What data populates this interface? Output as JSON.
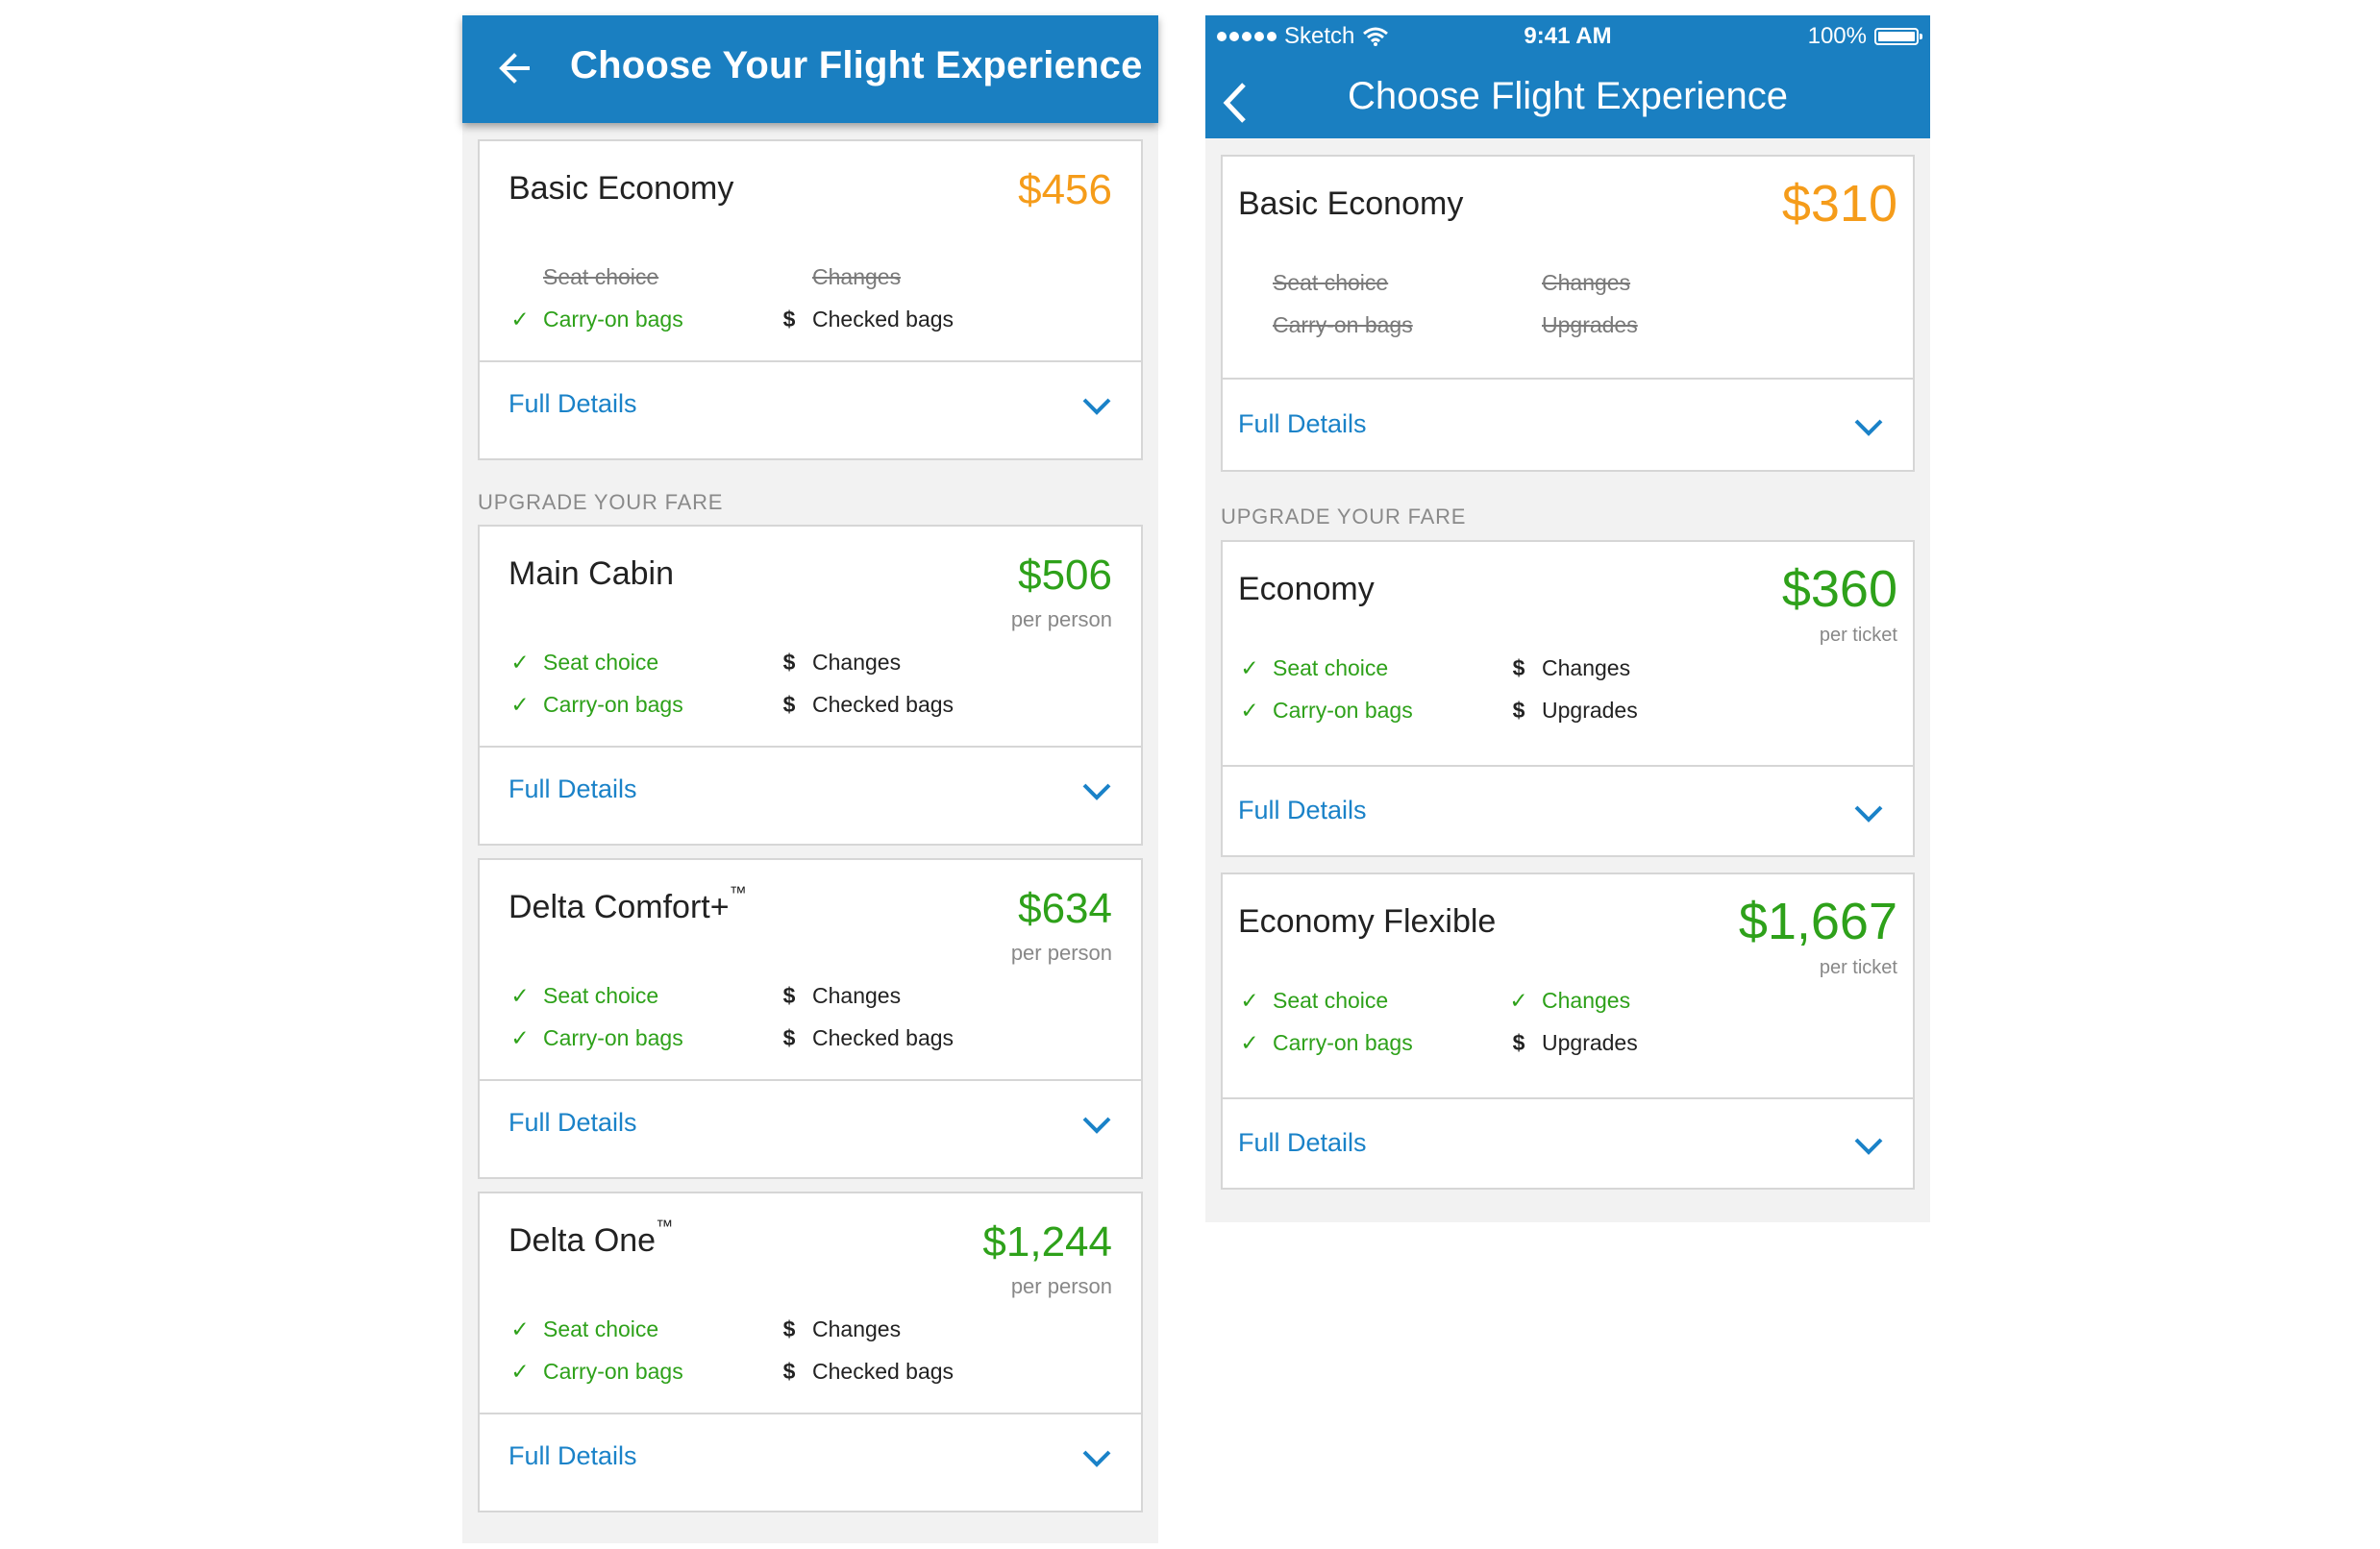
{
  "android": {
    "title": "Choose Your Flight Experience",
    "section_label": "UPGRADE YOUR FARE",
    "fares": [
      {
        "name": "Basic Economy",
        "price": "$456",
        "price_color": "#f59c1a",
        "per": "",
        "features": [
          {
            "label": "Seat choice",
            "status": "excluded"
          },
          {
            "label": "Changes",
            "status": "excluded"
          },
          {
            "label": "Carry-on bags",
            "status": "included"
          },
          {
            "label": "Checked bags",
            "status": "fee"
          }
        ],
        "details": "Full Details"
      },
      {
        "name": "Main Cabin",
        "price": "$506",
        "price_color": "#2ea11a",
        "per": "per person",
        "features": [
          {
            "label": "Seat choice",
            "status": "included"
          },
          {
            "label": "Changes",
            "status": "fee"
          },
          {
            "label": "Carry-on bags",
            "status": "included"
          },
          {
            "label": "Checked bags",
            "status": "fee"
          }
        ],
        "details": "Full Details"
      },
      {
        "name": "Delta Comfort+",
        "tm": "™",
        "price": "$634",
        "price_color": "#2ea11a",
        "per": "per person",
        "features": [
          {
            "label": "Seat choice",
            "status": "included"
          },
          {
            "label": "Changes",
            "status": "fee"
          },
          {
            "label": "Carry-on bags",
            "status": "included"
          },
          {
            "label": "Checked bags",
            "status": "fee"
          }
        ],
        "details": "Full Details"
      },
      {
        "name": "Delta One",
        "tm": "™",
        "price": "$1,244",
        "price_color": "#2ea11a",
        "per": "per person",
        "features": [
          {
            "label": "Seat choice",
            "status": "included"
          },
          {
            "label": "Changes",
            "status": "fee"
          },
          {
            "label": "Carry-on bags",
            "status": "included"
          },
          {
            "label": "Checked bags",
            "status": "fee"
          }
        ],
        "details": "Full Details"
      }
    ]
  },
  "ios": {
    "status": {
      "carrier": "Sketch",
      "time": "9:41 AM",
      "battery": "100%"
    },
    "title": "Choose Flight Experience",
    "section_label": "UPGRADE YOUR FARE",
    "fares": [
      {
        "name": "Basic Economy",
        "price": "$310",
        "price_color": "#f59c1a",
        "per": "",
        "features": [
          {
            "label": "Seat choice",
            "status": "excluded"
          },
          {
            "label": "Changes",
            "status": "excluded"
          },
          {
            "label": "Carry-on bags",
            "status": "excluded"
          },
          {
            "label": "Upgrades",
            "status": "excluded"
          }
        ],
        "details": "Full Details"
      },
      {
        "name": "Economy",
        "price": "$360",
        "price_color": "#2ea11a",
        "per": "per ticket",
        "features": [
          {
            "label": "Seat choice",
            "status": "included"
          },
          {
            "label": "Changes",
            "status": "fee"
          },
          {
            "label": "Carry-on bags",
            "status": "included"
          },
          {
            "label": "Upgrades",
            "status": "fee"
          }
        ],
        "details": "Full Details"
      },
      {
        "name": "Economy Flexible",
        "price": "$1,667",
        "price_color": "#2ea11a",
        "per": "per ticket",
        "features": [
          {
            "label": "Seat choice",
            "status": "included"
          },
          {
            "label": "Changes",
            "status": "included"
          },
          {
            "label": "Carry-on bags",
            "status": "included"
          },
          {
            "label": "Upgrades",
            "status": "fee"
          }
        ],
        "details": "Full Details"
      }
    ]
  }
}
